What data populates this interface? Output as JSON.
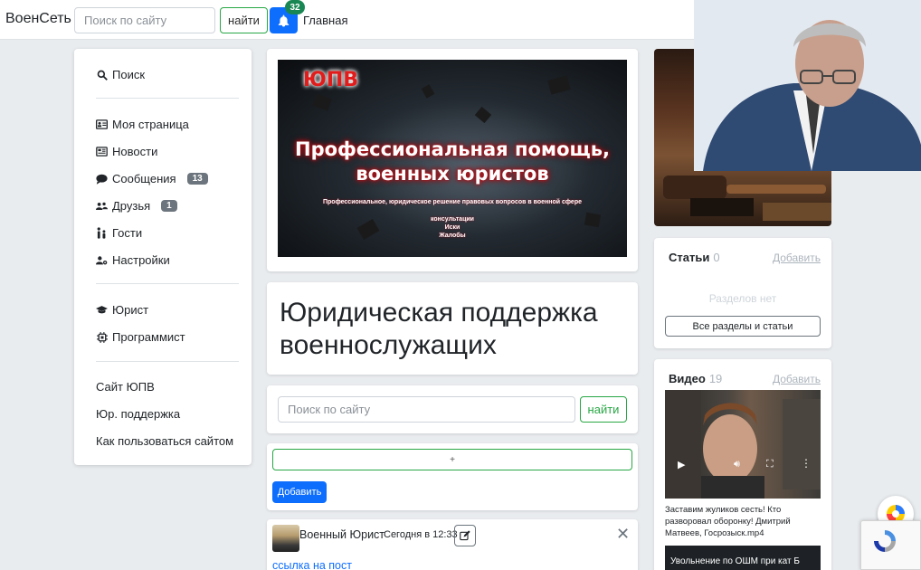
{
  "topbar": {
    "brand": "ВоенСеть",
    "search_placeholder": "Поиск по сайту",
    "find_label": "найти",
    "notifications_count": "32",
    "home_label": "Главная"
  },
  "sidebar": {
    "items": [
      {
        "label": "Поиск",
        "icon": "search-icon"
      },
      {
        "label": "Моя страница",
        "icon": "id-card-icon"
      },
      {
        "label": "Новости",
        "icon": "newspaper-icon"
      },
      {
        "label": "Сообщения",
        "icon": "comment-icon",
        "badge": "13"
      },
      {
        "label": "Друзья",
        "icon": "users-icon",
        "badge": "1"
      },
      {
        "label": "Гости",
        "icon": "guests-icon"
      },
      {
        "label": "Настройки",
        "icon": "user-cog-icon"
      },
      {
        "label": "Юрист",
        "icon": "graduation-cap-icon"
      },
      {
        "label": "Программист",
        "icon": "microchip-icon"
      }
    ],
    "links": [
      "Сайт ЮПВ",
      "Юр. поддержка",
      "Как пользоваться сайтом"
    ]
  },
  "banner": {
    "tag": "ЮПВ",
    "title_line1": "Профессиональная помощь,",
    "title_line2": "военных юристов",
    "subtitle": "Профессиональное, юридическое решение правовых вопросов в военной сфере",
    "lines": [
      "консультации",
      "Иски",
      "Жалобы"
    ]
  },
  "main": {
    "page_title": "Юридическая поддержка военнослужащих",
    "search_placeholder": "Поиск по сайту",
    "find_label": "найти",
    "add_field_text": "+",
    "add_button": "Добавить"
  },
  "post": {
    "author": "Военный Юрист",
    "time": "Сегодня в 12:33",
    "link_text": "ссылка на пост"
  },
  "articles": {
    "title": "Статьи",
    "count": "0",
    "add_label": "Добавить",
    "empty_text": "Разделов нет",
    "all_button": "Все разделы и статьи"
  },
  "videos": {
    "title": "Видео",
    "count": "19",
    "add_label": "Добавить",
    "caption": "Заставим жуликов сесть! Кто разворовал оборонку! Дмитрий Матвеев, Госрозыск.mp4",
    "next_preview_text": "Увольнение по ОШМ при кат Б"
  },
  "colors": {
    "primary": "#0d6efd",
    "success": "#28a745",
    "badge_green": "#198754",
    "badge_gray": "#6c757d",
    "background": "#e9ecef"
  }
}
